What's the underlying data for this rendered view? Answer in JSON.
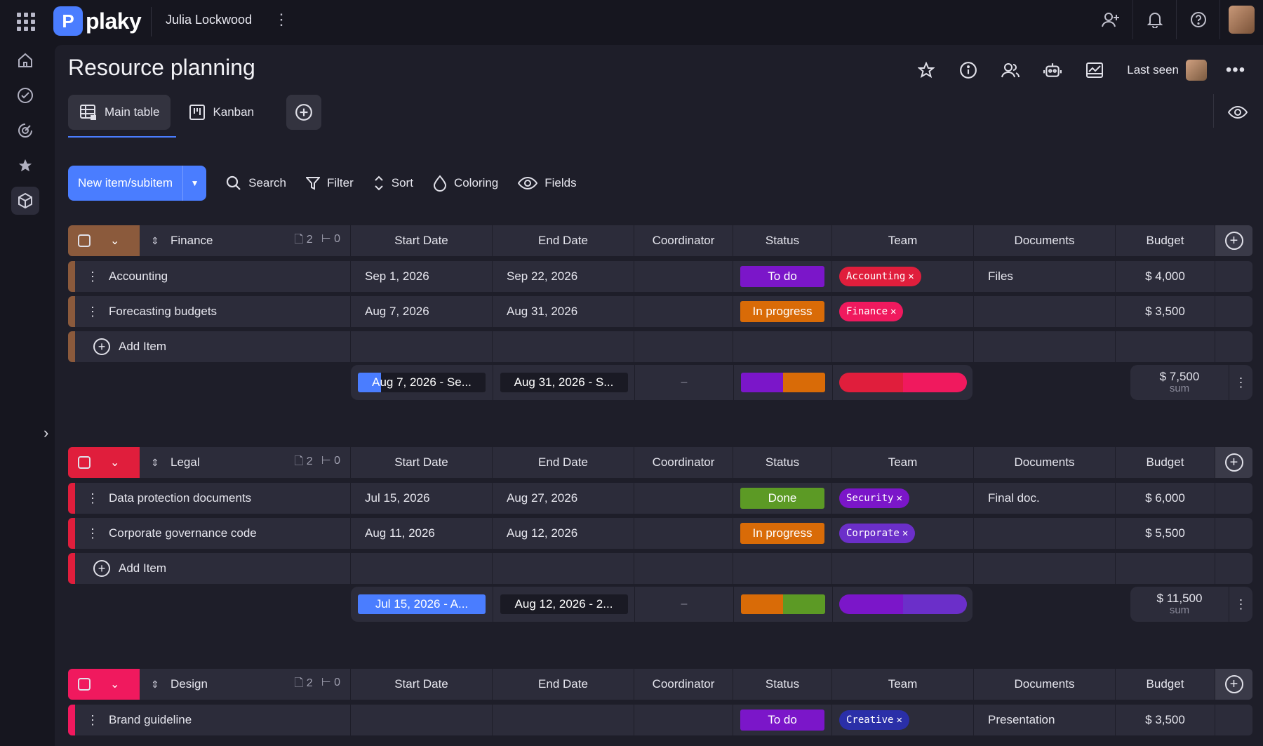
{
  "app": {
    "logo_text": "plaky",
    "workspace": "Julia Lockwood"
  },
  "page": {
    "title": "Resource planning",
    "last_seen_label": "Last seen"
  },
  "tabs": [
    {
      "label": "Main table",
      "active": true
    },
    {
      "label": "Kanban",
      "active": false
    }
  ],
  "toolbar": {
    "new_item": "New item/subitem",
    "search": "Search",
    "filter": "Filter",
    "sort": "Sort",
    "coloring": "Coloring",
    "fields": "Fields"
  },
  "columns": {
    "start_date": "Start Date",
    "end_date": "End Date",
    "coordinator": "Coordinator",
    "status": "Status",
    "team": "Team",
    "documents": "Documents",
    "budget": "Budget"
  },
  "add_item_label": "Add Item",
  "sum_label": "sum",
  "coordinator_empty": "–",
  "groups": [
    {
      "name": "Finance",
      "color": "#8b5a3c",
      "items_count": "2",
      "subitems_count": "0",
      "items": [
        {
          "name": "Accounting",
          "start": "Sep 1, 2026",
          "end": "Sep 22, 2026",
          "status": "To do",
          "status_color": "#7b16c9",
          "team": "Accounting",
          "team_color": "#e01e3c",
          "doc": "Files",
          "budget": "$ 4,000"
        },
        {
          "name": "Forecasting budgets",
          "start": "Aug 7, 2026",
          "end": "Aug 31, 2026",
          "status": "In progress",
          "status_color": "#d96b07",
          "team": "Finance",
          "team_color": "#f0195e",
          "doc": "",
          "budget": "$ 3,500"
        }
      ],
      "summary": {
        "start_range": "Aug 7, 2026 - Se...",
        "start_fill": 0.18,
        "start_fill_color": "#4a7dff",
        "end_range": "Aug 31, 2026 - S...",
        "end_fill": 0,
        "end_fill_color": "#4a7dff",
        "status_colors": [
          "#7b16c9",
          "#d96b07"
        ],
        "team_colors": [
          "#e01e3c",
          "#f0195e"
        ],
        "budget": "$ 7,500"
      }
    },
    {
      "name": "Legal",
      "color": "#e01e3c",
      "items_count": "2",
      "subitems_count": "0",
      "items": [
        {
          "name": "Data protection documents",
          "start": "Jul 15, 2026",
          "end": "Aug 27, 2026",
          "status": "Done",
          "status_color": "#5c9a25",
          "team": "Security",
          "team_color": "#7b16c9",
          "doc": "Final doc.",
          "budget": "$ 6,000"
        },
        {
          "name": "Corporate governance code",
          "start": "Aug 11, 2026",
          "end": "Aug 12, 2026",
          "status": "In progress",
          "status_color": "#d96b07",
          "team": "Corporate",
          "team_color": "#6b2fc9",
          "doc": "",
          "budget": "$ 5,500"
        }
      ],
      "summary": {
        "start_range": "Jul 15, 2026 - A...",
        "start_fill": 1,
        "start_fill_color": "#4a7dff",
        "end_range": "Aug 12, 2026 - 2...",
        "end_fill": 0,
        "end_fill_color": "#4a7dff",
        "status_colors": [
          "#d96b07",
          "#5c9a25"
        ],
        "team_colors": [
          "#7b16c9",
          "#6b2fc9"
        ],
        "budget": "$ 11,500"
      }
    },
    {
      "name": "Design",
      "color": "#f0195e",
      "items_count": "2",
      "subitems_count": "0",
      "items": [
        {
          "name": "Brand guideline",
          "start": "",
          "end": "",
          "status": "To do",
          "status_color": "#7b16c9",
          "team": "Creative",
          "team_color": "#2a2fa8",
          "doc": "Presentation",
          "budget": "$ 3,500"
        }
      ]
    }
  ],
  "icons": {
    "apps": "grid-icon",
    "home": "home-icon",
    "tasks": "check-circle-icon",
    "activity": "radar-icon",
    "favorites": "star-icon",
    "workspace": "cube-icon",
    "invite": "add-user-icon",
    "bell": "bell-icon",
    "help": "question-icon",
    "star": "star-icon",
    "info": "info-icon",
    "members": "users-icon",
    "automation": "robot-icon",
    "activity_log": "chart-icon",
    "eye": "eye-icon"
  }
}
